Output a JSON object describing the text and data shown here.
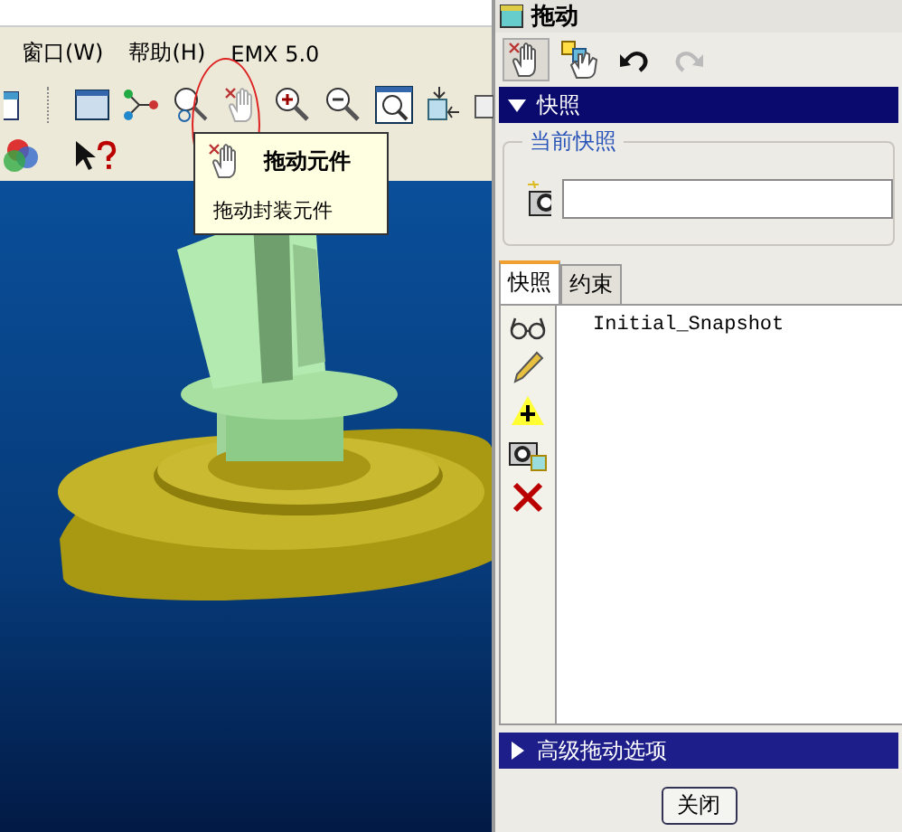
{
  "menu": [
    {
      "label": "窗口(W)"
    },
    {
      "label": "帮助(H)"
    },
    {
      "label": "EMX 5.0"
    }
  ],
  "tooltip": {
    "title": "拖动元件",
    "description": "拖动封装元件"
  },
  "dialog": {
    "title": "拖动",
    "tools": [
      {
        "kind": "drag",
        "selected": true,
        "disabled": false
      },
      {
        "kind": "drag-multi",
        "selected": false,
        "disabled": false
      },
      {
        "kind": "undo",
        "selected": false,
        "disabled": false
      },
      {
        "kind": "redo",
        "selected": false,
        "disabled": true
      }
    ],
    "snapshot_section": {
      "title": "快照",
      "expanded": true
    },
    "current_snapshot": {
      "title": "当前快照"
    },
    "tabs": [
      {
        "label": "快照",
        "selected": true
      },
      {
        "label": "约束",
        "selected": false
      }
    ],
    "snapshots": [
      {
        "name": "Initial_Snapshot"
      }
    ],
    "advanced_section": {
      "title": "高级拖动选项",
      "expanded": false
    },
    "buttons": [
      "关闭"
    ]
  }
}
